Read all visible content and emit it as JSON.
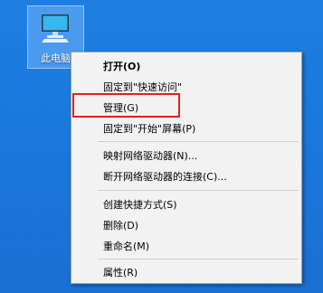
{
  "desktop": {
    "icon": {
      "label": "此电脑",
      "icon_name": "computer-icon"
    }
  },
  "context_menu": {
    "items": [
      {
        "label": "打开(O)",
        "bold": true
      },
      {
        "label": "固定到\"快速访问\""
      },
      {
        "label": "管理(G)",
        "highlighted": true
      },
      {
        "label": "固定到\"开始\"屏幕(P)"
      },
      {
        "label": "映射网络驱动器(N)..."
      },
      {
        "label": "断开网络驱动器的连接(C)..."
      },
      {
        "label": "创建快捷方式(S)"
      },
      {
        "label": "删除(D)"
      },
      {
        "label": "重命名(M)"
      },
      {
        "label": "属性(R)"
      }
    ]
  },
  "colors": {
    "desktop_background": "#1a78dc",
    "menu_background": "#f2f2f2",
    "highlight_border": "#e0201e"
  }
}
